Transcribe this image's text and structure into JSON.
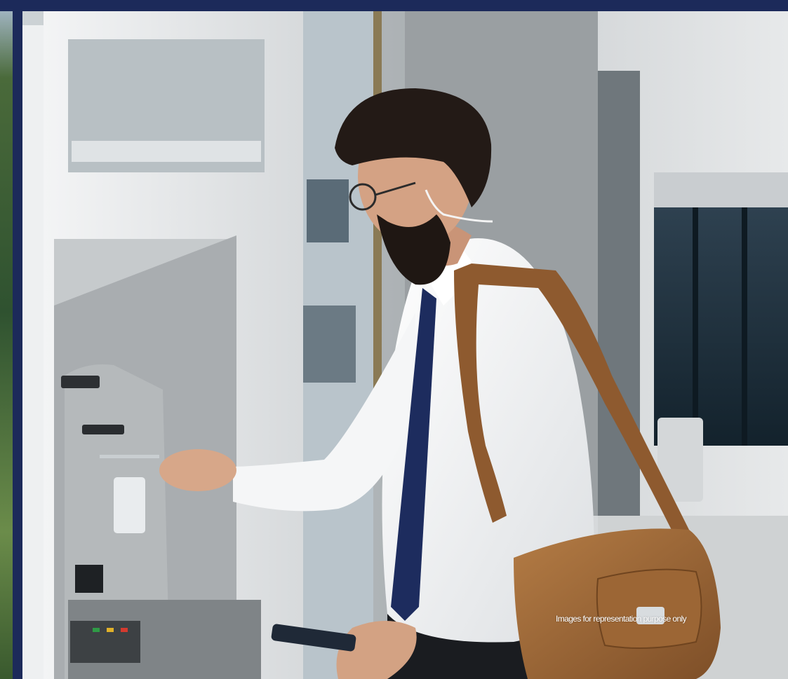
{
  "photo": {
    "subject": "photo-man-at-atm",
    "icons": [
      "atm-machine-icon",
      "person-icon",
      "shoulder-bag-icon",
      "phone-icon"
    ]
  },
  "caption": {
    "disclaimer": "Images for representation purpose only"
  },
  "colors": {
    "frame": "#1c2a5a",
    "atm_body": "#e6e8ea",
    "shirt": "#f2f2f2",
    "bag": "#a06a3a",
    "tie": "#1d2c5e",
    "caption_text": "#ffffff"
  }
}
